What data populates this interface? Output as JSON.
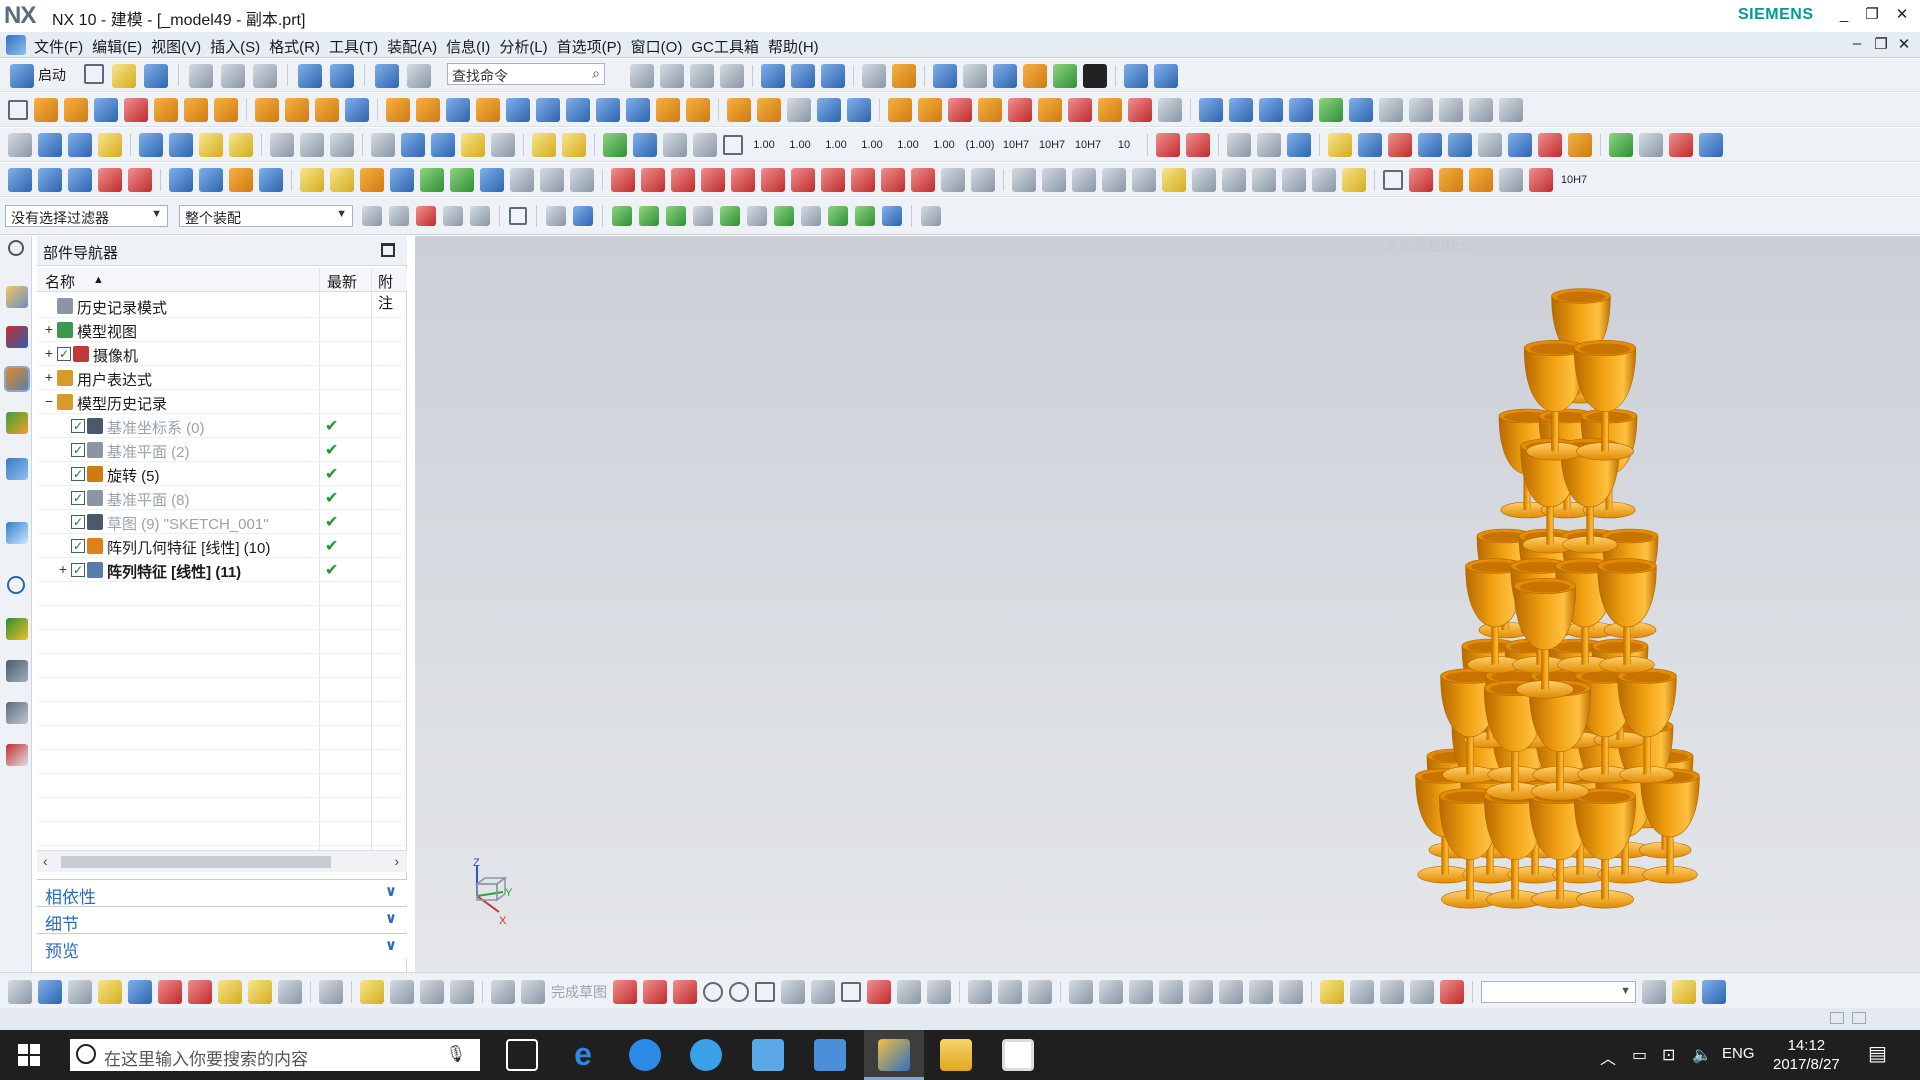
{
  "window": {
    "logo": "NX",
    "title": "NX 10 - 建模 - [_model49 - 副本.prt]",
    "brand": "SIEMENS",
    "min": "_",
    "restore": "❐",
    "close": "✕"
  },
  "menu": {
    "items": [
      "文件(F)",
      "编辑(E)",
      "视图(V)",
      "插入(S)",
      "格式(R)",
      "工具(T)",
      "装配(A)",
      "信息(I)",
      "分析(L)",
      "首选项(P)",
      "窗口(O)",
      "GC工具箱",
      "帮助(H)"
    ],
    "doc_min": "–",
    "doc_restore": "❐",
    "doc_close": "✕"
  },
  "toolbar": {
    "start_label": "启动",
    "search_placeholder": "查找命令",
    "tolerance_labels": [
      "1.00",
      "1.00",
      "1.00",
      "1.00",
      "1.00",
      "1.00",
      "(1.00)",
      "10H7",
      "10H7",
      "10H7",
      "10"
    ]
  },
  "filter": {
    "selection_filter": "没有选择过滤器",
    "assembly_scope": "整个装配"
  },
  "navigator": {
    "title": "部件导航器",
    "columns": {
      "name": "名称",
      "latest": "最新",
      "notes": "附注"
    },
    "rows": [
      {
        "label": "历史记录模式",
        "level": 0,
        "expander": "",
        "checked": false,
        "style": "normal",
        "latest": ""
      },
      {
        "label": "模型视图",
        "level": 0,
        "expander": "+",
        "checked": false,
        "style": "normal",
        "latest": ""
      },
      {
        "label": "摄像机",
        "level": 0,
        "expander": "+",
        "checked": true,
        "style": "normal",
        "latest": ""
      },
      {
        "label": "用户表达式",
        "level": 0,
        "expander": "+",
        "checked": false,
        "style": "normal",
        "latest": ""
      },
      {
        "label": "模型历史记录",
        "level": 0,
        "expander": "−",
        "checked": false,
        "style": "normal",
        "latest": ""
      },
      {
        "label": "基准坐标系 (0)",
        "level": 1,
        "expander": "",
        "checked": true,
        "style": "dim",
        "latest": "✔"
      },
      {
        "label": "基准平面 (2)",
        "level": 1,
        "expander": "",
        "checked": true,
        "style": "dim",
        "latest": "✔"
      },
      {
        "label": "旋转 (5)",
        "level": 1,
        "expander": "",
        "checked": true,
        "style": "normal",
        "latest": "✔"
      },
      {
        "label": "基准平面 (8)",
        "level": 1,
        "expander": "",
        "checked": true,
        "style": "dim",
        "latest": "✔"
      },
      {
        "label": "草图 (9) \"SKETCH_001\"",
        "level": 1,
        "expander": "",
        "checked": true,
        "style": "dim",
        "latest": "✔"
      },
      {
        "label": "阵列几何特征 [线性] (10)",
        "level": 1,
        "expander": "",
        "checked": true,
        "style": "normal",
        "latest": "✔"
      },
      {
        "label": "阵列特征 [线性] (11)",
        "level": 1,
        "expander": "+",
        "checked": true,
        "style": "bold",
        "latest": "✔"
      }
    ],
    "panels": [
      "相依性",
      "细节",
      "预览"
    ]
  },
  "viewport": {
    "faint_label": "全屏幕截图(S)",
    "axis_z": "Z",
    "axis_x": "X",
    "axis_y": "Y",
    "goblet_color": "#f0a010"
  },
  "bottombar": {
    "finish_sketch": "完成草图"
  },
  "taskbar": {
    "search_placeholder": "在这里输入你要搜索的内容",
    "lang": "ENG",
    "time": "14:12",
    "date": "2017/8/27"
  },
  "colors": {
    "accent": "#2b6cc0",
    "brand": "#009999",
    "check": "#1f9a2a"
  }
}
